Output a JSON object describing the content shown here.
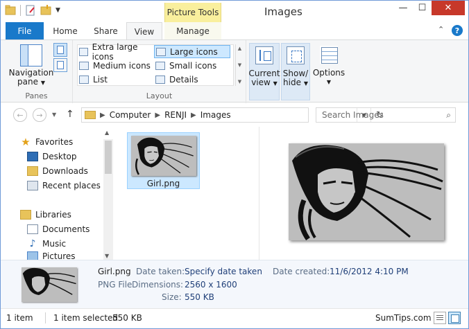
{
  "window": {
    "title": "Images",
    "contextual_tab_group": "Picture Tools"
  },
  "title_controls": {
    "minimize": "—",
    "maximize": "☐",
    "close": "✕"
  },
  "ribbon_tabs": [
    {
      "label": "File"
    },
    {
      "label": "Home"
    },
    {
      "label": "Share"
    },
    {
      "label": "View"
    },
    {
      "label": "Manage"
    }
  ],
  "ribbon_controls": {
    "collapse": "⌃",
    "help": "?"
  },
  "ribbon": {
    "panes": {
      "group_label": "Panes",
      "navigation_pane_line1": "Navigation",
      "navigation_pane_line2": "pane"
    },
    "layout": {
      "group_label": "Layout",
      "items": [
        {
          "label": "Extra large icons"
        },
        {
          "label": "Large icons",
          "selected": true
        },
        {
          "label": "Medium icons"
        },
        {
          "label": "Small icons"
        },
        {
          "label": "List"
        },
        {
          "label": "Details"
        }
      ]
    },
    "current_view_line1": "Current",
    "current_view_line2": "view",
    "show_hide_line1": "Show/",
    "show_hide_line2": "hide",
    "options": "Options"
  },
  "address": {
    "breadcrumbs": [
      "Computer",
      "RENJI",
      "Images"
    ]
  },
  "search": {
    "placeholder": "Search Images"
  },
  "nav_tree": {
    "favorites": "Favorites",
    "favorites_items": [
      "Desktop",
      "Downloads",
      "Recent places"
    ],
    "libraries": "Libraries",
    "libraries_items": [
      "Documents",
      "Music",
      "Pictures"
    ]
  },
  "files": [
    {
      "name": "Girl.png",
      "selected": true
    }
  ],
  "details": {
    "name": "Girl.png",
    "type": "PNG File",
    "date_taken_label": "Date taken:",
    "date_taken_value": "Specify date taken",
    "dimensions_label": "Dimensions:",
    "dimensions_value": "2560 x 1600",
    "size_label": "Size:",
    "size_value": "550 KB",
    "date_created_label": "Date created:",
    "date_created_value": "11/6/2012 4:10 PM"
  },
  "status": {
    "item_count": "1 item",
    "selected": "1 item selected",
    "selected_size": "550 KB",
    "watermark": "SumTips.com"
  },
  "colors": {
    "accent": "#1979ca",
    "close_button": "#c7382a",
    "contextual_tab": "#f9ef9d",
    "selection": "#cce8ff"
  }
}
